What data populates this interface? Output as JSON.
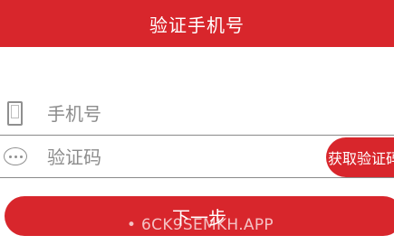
{
  "header": {
    "title": "验证手机号"
  },
  "form": {
    "phone": {
      "placeholder": "手机号",
      "value": "",
      "icon": "phone-icon"
    },
    "code": {
      "placeholder": "验证码",
      "value": "",
      "icon": "chat-bubble-icon",
      "get_code_label": "获取验证码"
    }
  },
  "next_button_label": "下一步",
  "watermark": "• 6CK9SEMKH.APP",
  "colors": {
    "accent": "#d8262c",
    "divider": "#8a8a8a",
    "placeholder": "#8c8c8c"
  }
}
